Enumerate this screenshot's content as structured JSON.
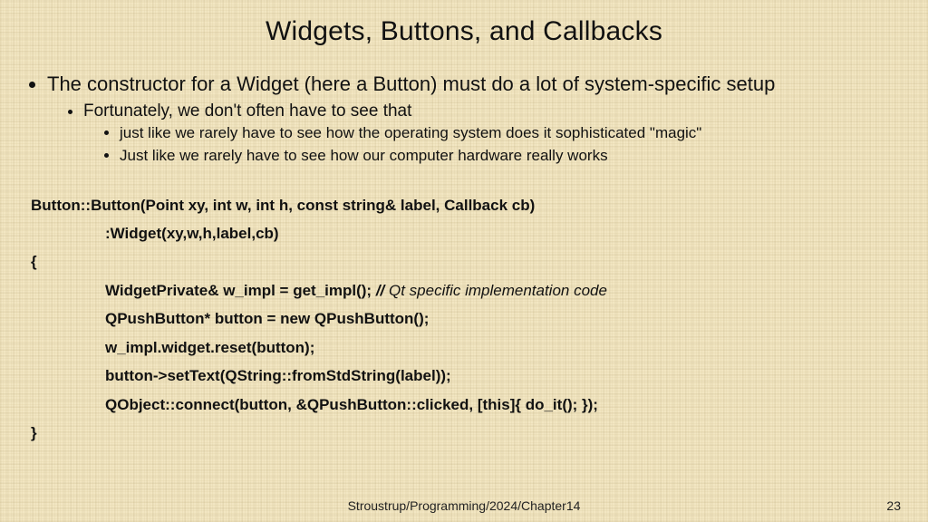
{
  "title": "Widgets, Buttons, and Callbacks",
  "bullets": {
    "main": "The constructor for a Widget (here a Button) must do a lot of system-specific setup",
    "sub1": "Fortunately, we don't often have to see that",
    "sub2a": "just like we rarely have to see how the operating system does it sophisticated \"magic\"",
    "sub2b": "Just like we rarely have to see how our computer hardware really works"
  },
  "code": {
    "l1": "Button::Button(Point xy, int w, int h, const string& label, Callback cb)",
    "l2": ":Widget(xy,w,h,label,cb)",
    "l3": "{",
    "l4a": "WidgetPrivate& w_impl = get_impl();",
    "l4b_slashes": "// ",
    "l4b_text": "Qt specific implementation code",
    "l5": "QPushButton* button = new QPushButton();",
    "l6": "w_impl.widget.reset(button);",
    "l7": "button->setText(QString::fromStdString(label));",
    "l8": "QObject::connect(button, &QPushButton::clicked, [this]{ do_it(); });",
    "l9": "}"
  },
  "footer": "Stroustrup/Programming/2024/Chapter14",
  "page": "23"
}
